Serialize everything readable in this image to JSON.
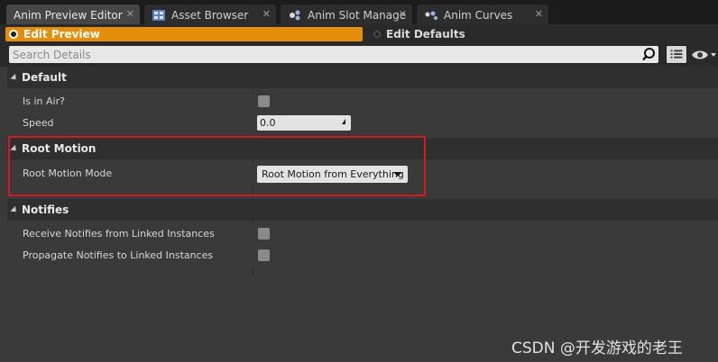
{
  "tabs": [
    {
      "label": "Anim Preview Editor",
      "icon": "preview-icon",
      "active": true
    },
    {
      "label": "Asset Browser",
      "icon": "asset-browser-icon",
      "active": false
    },
    {
      "label": "Anim Slot Manage",
      "icon": "slot-manager-icon",
      "active": false
    },
    {
      "label": "Anim Curves",
      "icon": "curves-icon",
      "active": false
    }
  ],
  "tab_close_glyph": "✕",
  "mode": {
    "edit_preview": "Edit Preview",
    "edit_defaults": "Edit Defaults"
  },
  "search": {
    "placeholder": "Search Details"
  },
  "categories": {
    "default": {
      "title": "Default",
      "props": {
        "is_in_air": {
          "label": "Is in Air?",
          "checked": false
        },
        "speed": {
          "label": "Speed",
          "value": "0.0"
        }
      }
    },
    "root_motion": {
      "title": "Root Motion",
      "props": {
        "mode": {
          "label": "Root Motion Mode",
          "value": "Root Motion from Everything"
        }
      }
    },
    "notifies": {
      "title": "Notifies",
      "props": {
        "receive": {
          "label": "Receive Notifies from Linked Instances",
          "checked": false
        },
        "propagate": {
          "label": "Propagate Notifies to Linked Instances",
          "checked": false
        }
      }
    }
  },
  "colors": {
    "accent": "#e58e0c",
    "highlight": "#d9181e"
  },
  "watermark": "CSDN @开发游戏的老王"
}
